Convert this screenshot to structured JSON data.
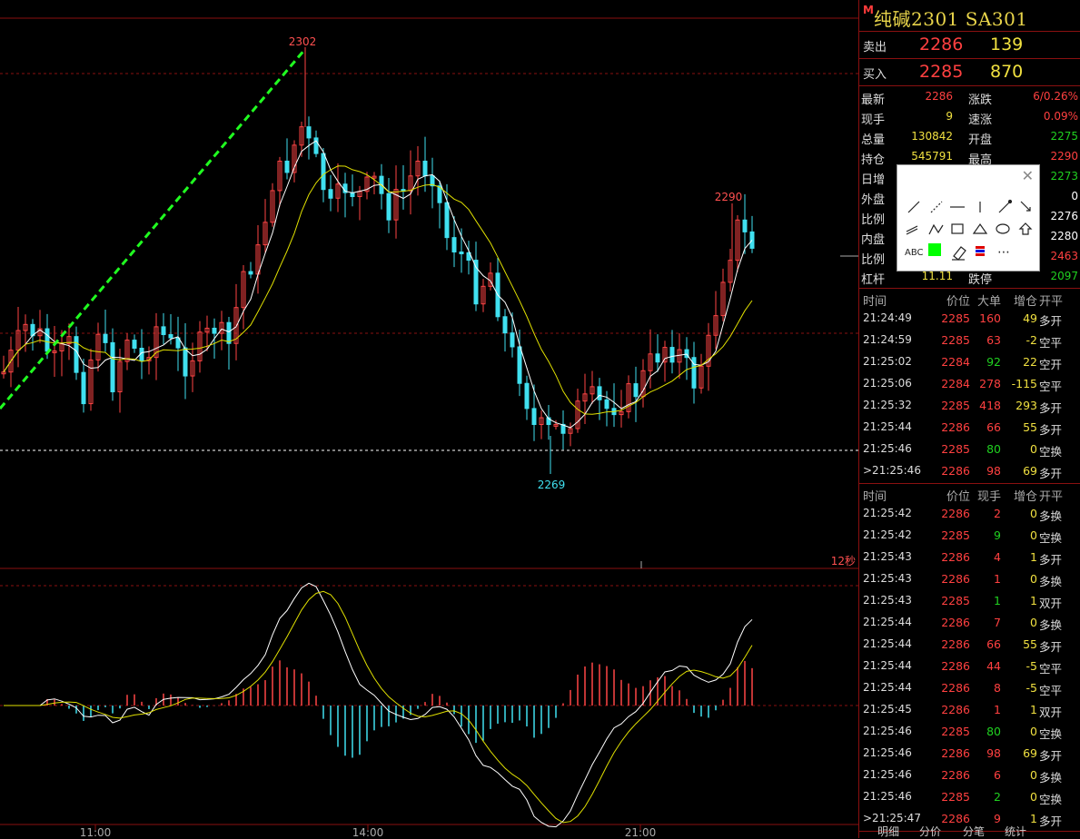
{
  "instrument": {
    "marker": "M",
    "title": "纯碱2301  SA301"
  },
  "orderbook": {
    "sell": {
      "label": "卖出",
      "price": "2286",
      "volume": "139"
    },
    "buy": {
      "label": "买入",
      "price": "2285",
      "volume": "870"
    }
  },
  "stats": [
    {
      "l1": "最新",
      "v1": "2286",
      "c1": "#ff4040",
      "l2": "涨跌",
      "v2": "6/0.26%",
      "c2": "#ff4040"
    },
    {
      "l1": "现手",
      "v1": "9",
      "c1": "#f0e040",
      "l2": "速涨",
      "v2": "0.09%",
      "c2": "#ff4040"
    },
    {
      "l1": "总量",
      "v1": "130842",
      "c1": "#f0e040",
      "l2": "开盘",
      "v2": "2275",
      "c2": "#20d020"
    },
    {
      "l1": "持仓",
      "v1": "545791",
      "c1": "#f0e040",
      "l2": "最高",
      "v2": "2290",
      "c2": "#ff4040"
    },
    {
      "l1": "日增",
      "v1": "",
      "c1": "#f0e040",
      "l2": "",
      "v2": "2273",
      "c2": "#20d020"
    },
    {
      "l1": "外盘",
      "v1": "",
      "c1": "#f0e040",
      "l2": "",
      "v2": "0",
      "c2": "#ffffff"
    },
    {
      "l1": "比例",
      "v1": "",
      "c1": "#f0e040",
      "l2": "",
      "v2": "2276",
      "c2": "#ffffff"
    },
    {
      "l1": "内盘",
      "v1": "",
      "c1": "#f0e040",
      "l2": "",
      "v2": "2280",
      "c2": "#ffffff"
    },
    {
      "l1": "比例",
      "v1": "",
      "c1": "#f0e040",
      "l2": "",
      "v2": "2463",
      "c2": "#ff4040"
    },
    {
      "l1": "杠杆",
      "v1": "11.11",
      "c1": "#f0e040",
      "l2": "跌停",
      "v2": "2097",
      "c2": "#20d020"
    }
  ],
  "bigorders": {
    "headers": [
      "时间",
      "价位",
      "大单",
      "增仓",
      "开平"
    ],
    "rows": [
      {
        "t": "21:24:49",
        "p": "2285",
        "v": "160",
        "vc": "#ff4040",
        "d": "49",
        "ty": "多开"
      },
      {
        "t": "21:24:59",
        "p": "2285",
        "v": "63",
        "vc": "#ff4040",
        "d": "-2",
        "ty": "空平"
      },
      {
        "t": "21:25:02",
        "p": "2284",
        "v": "92",
        "vc": "#20d020",
        "d": "22",
        "ty": "空开"
      },
      {
        "t": "21:25:06",
        "p": "2284",
        "v": "278",
        "vc": "#ff4040",
        "d": "-115",
        "ty": "空平"
      },
      {
        "t": "21:25:32",
        "p": "2285",
        "v": "418",
        "vc": "#ff4040",
        "d": "293",
        "ty": "多开"
      },
      {
        "t": "21:25:44",
        "p": "2286",
        "v": "66",
        "vc": "#ff4040",
        "d": "55",
        "ty": "多开"
      },
      {
        "t": "21:25:46",
        "p": "2285",
        "v": "80",
        "vc": "#20d020",
        "d": "0",
        "ty": "空换"
      },
      {
        "t": ">21:25:46",
        "p": "2286",
        "v": "98",
        "vc": "#ff4040",
        "d": "69",
        "ty": "多开"
      }
    ]
  },
  "ticks": {
    "headers": [
      "时间",
      "价位",
      "现手",
      "增仓",
      "开平"
    ],
    "rows": [
      {
        "t": "21:25:42",
        "p": "2286",
        "v": "2",
        "vc": "#ff4040",
        "d": "0",
        "ty": "多换"
      },
      {
        "t": "21:25:42",
        "p": "2285",
        "v": "9",
        "vc": "#20d020",
        "d": "0",
        "ty": "空换"
      },
      {
        "t": "21:25:43",
        "p": "2286",
        "v": "4",
        "vc": "#ff4040",
        "d": "1",
        "ty": "多开"
      },
      {
        "t": "21:25:43",
        "p": "2286",
        "v": "1",
        "vc": "#ff4040",
        "d": "0",
        "ty": "多换"
      },
      {
        "t": "21:25:43",
        "p": "2285",
        "v": "1",
        "vc": "#20d020",
        "d": "1",
        "ty": "双开"
      },
      {
        "t": "21:25:44",
        "p": "2286",
        "v": "7",
        "vc": "#ff4040",
        "d": "0",
        "ty": "多换"
      },
      {
        "t": "21:25:44",
        "p": "2286",
        "v": "66",
        "vc": "#ff4040",
        "d": "55",
        "ty": "多开"
      },
      {
        "t": "21:25:44",
        "p": "2286",
        "v": "44",
        "vc": "#ff4040",
        "d": "-5",
        "ty": "空平"
      },
      {
        "t": "21:25:44",
        "p": "2286",
        "v": "8",
        "vc": "#ff4040",
        "d": "-5",
        "ty": "空平"
      },
      {
        "t": "21:25:45",
        "p": "2286",
        "v": "1",
        "vc": "#ff4040",
        "d": "1",
        "ty": "双开"
      },
      {
        "t": "21:25:46",
        "p": "2285",
        "v": "80",
        "vc": "#20d020",
        "d": "0",
        "ty": "空换"
      },
      {
        "t": "21:25:46",
        "p": "2286",
        "v": "98",
        "vc": "#ff4040",
        "d": "69",
        "ty": "多开"
      },
      {
        "t": "21:25:46",
        "p": "2286",
        "v": "6",
        "vc": "#ff4040",
        "d": "0",
        "ty": "多换"
      },
      {
        "t": "21:25:46",
        "p": "2285",
        "v": "2",
        "vc": "#20d020",
        "d": "0",
        "ty": "空换"
      },
      {
        "t": ">21:25:47",
        "p": "2286",
        "v": "9",
        "vc": "#ff4040",
        "d": "1",
        "ty": "多开"
      }
    ]
  },
  "tabs": [
    "明细",
    "分价",
    "分笔",
    "统计"
  ],
  "chart_data": {
    "type": "candlestick",
    "high_label": "2302",
    "low_label": "2269",
    "recent_high_label": "2290",
    "timer_label": "12秒",
    "x_ticks": [
      "11:00",
      "14:00",
      "21:00"
    ],
    "colors": {
      "up": "#ff4545",
      "down": "#40e0f0",
      "ma_fast": "#ffffff",
      "ma_slow": "#e0e000",
      "trend": "#20ff20"
    }
  },
  "toolbox": {
    "abc_label": "ABC",
    "more_label": "⋯"
  }
}
